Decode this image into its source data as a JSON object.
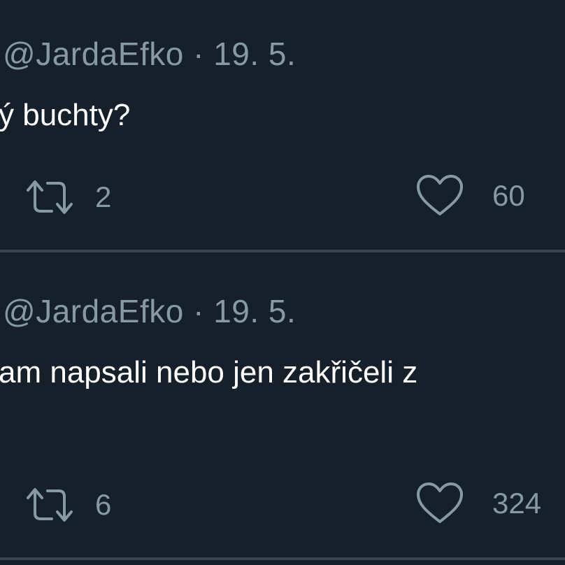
{
  "tweets": [
    {
      "handle": "@JardaEfko",
      "separator": "·",
      "date": "19. 5.",
      "text": "ý buchty?",
      "retweet_icon": "retweet-icon",
      "retweets": "2",
      "like_icon": "heart-icon",
      "likes": "60"
    },
    {
      "handle": "@JardaEfko",
      "separator": "·",
      "date": "19. 5.",
      "text": "am napsali nebo jen zakřičeli z",
      "retweet_icon": "retweet-icon",
      "retweets": "6",
      "like_icon": "heart-icon",
      "likes": "324"
    }
  ],
  "colors": {
    "background": "#15202b",
    "text": "#ffffff",
    "secondary": "#8899a6",
    "divider": "#38444d"
  }
}
